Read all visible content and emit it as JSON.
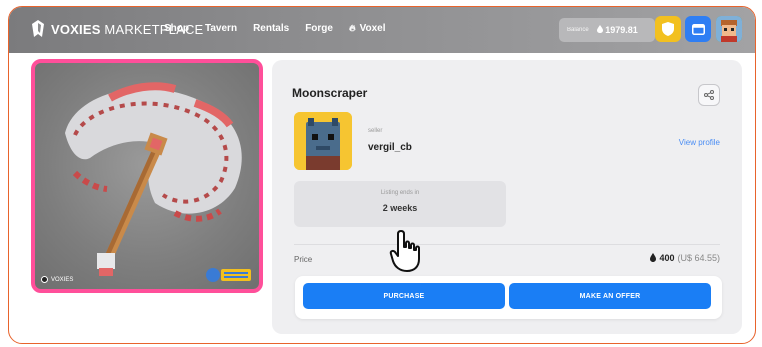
{
  "nav": {
    "brand_bold": "VOXIES",
    "brand_light": "MARKETPLACE",
    "items": [
      {
        "label": "Shop"
      },
      {
        "label": "Tavern"
      },
      {
        "label": "Rentals"
      },
      {
        "label": "Forge"
      },
      {
        "label": "Voxel",
        "glyph": "voxel-icon"
      }
    ],
    "balance_label": "Balance",
    "balance_value": "1979.81",
    "icons": [
      "shield-icon",
      "window-icon"
    ]
  },
  "nft": {
    "badge_text": "VOXIES",
    "brand_logo": "voxies-marketplace-logo",
    "border_color": "#ff4f9a"
  },
  "item": {
    "title": "Moonscraper",
    "seller_label": "seller",
    "seller_name": "vergil_cb",
    "view_profile": "View profile",
    "listing_label": "Listing ends in",
    "listing_value": "2 weeks",
    "price_label": "Price",
    "price_value": "400",
    "price_usd": "(U$ 64.55)",
    "purchase_label": "PURCHASE",
    "offer_label": "MAKE AN OFFER"
  },
  "colors": {
    "accent_blue": "#1a7ef5",
    "frame_orange": "#e8632c",
    "nft_pink": "#ff4f9a",
    "yellow": "#f2c01f"
  }
}
